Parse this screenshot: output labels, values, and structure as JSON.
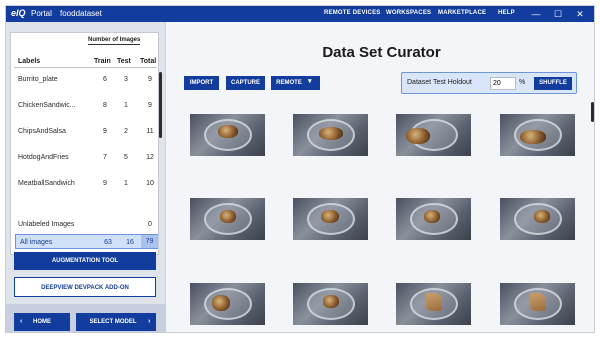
{
  "titlebar": {
    "logo": "eIQ",
    "logo_sub": "Portal",
    "dataset": "fooddataset",
    "nav": [
      "REMOTE DEVICES",
      "WORKSPACES",
      "MARKETPLACE",
      "HELP"
    ],
    "minimize": "—",
    "maximize": "☐",
    "close": "✕"
  },
  "sidebar": {
    "group_header": "Number of Images",
    "col_labels": "Labels",
    "col_train": "Train",
    "col_test": "Test",
    "col_total": "Total",
    "rows": [
      {
        "label": "Burrito_plate",
        "train": "6",
        "test": "3",
        "total": "9"
      },
      {
        "label": "ChickenSandwic...",
        "train": "8",
        "test": "1",
        "total": "9"
      },
      {
        "label": "ChipsAndSalsa",
        "train": "9",
        "test": "2",
        "total": "11"
      },
      {
        "label": "HotdogAndFries",
        "train": "7",
        "test": "5",
        "total": "12"
      },
      {
        "label": "MeatballSandwich",
        "train": "9",
        "test": "1",
        "total": "10"
      }
    ],
    "unlabeled": {
      "label": "Unlabeled Images",
      "total": "0"
    },
    "all_images": {
      "label": "All images",
      "train": "63",
      "test": "16",
      "total": "79"
    },
    "augmentation_button": "AUGMENTATION TOOL",
    "devpack_button": "DEEPVIEW DEVPACK ADD-ON",
    "home_button": "HOME",
    "select_model_button": "SELECT MODEL"
  },
  "main": {
    "title": "Data Set Curator",
    "import_button": "IMPORT",
    "capture_button": "CAPTURE",
    "remote_button": "REMOTE",
    "holdout_label": "Dataset Test Holdout",
    "holdout_value": "20",
    "holdout_unit": "%",
    "shuffle_button": "SHUFFLE"
  },
  "colors": {
    "brand": "#123d9e",
    "selection": "#cfe0f7"
  },
  "icons": {
    "remote_dropdown": "chevron-down-icon",
    "home": "chevron-left-icon",
    "select_model": "chevron-right-icon"
  }
}
